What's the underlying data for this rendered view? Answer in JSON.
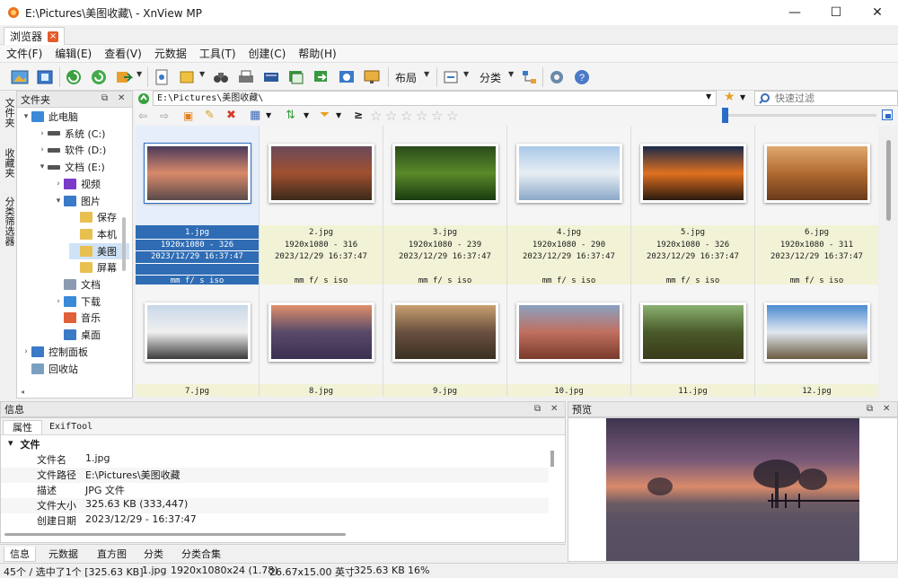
{
  "window": {
    "title": "E:\\Pictures\\美图收藏\\ - XnView MP",
    "tab": "浏览器",
    "tab_close": "×",
    "minimize": "—",
    "maximize": "☐",
    "close": "✕"
  },
  "menu": [
    "文件(F)",
    "编辑(E)",
    "查看(V)",
    "元数据",
    "工具(T)",
    "创建(C)",
    "帮助(H)"
  ],
  "toolbar": {
    "layout_label": "布局",
    "category_label": "分类"
  },
  "side_tabs": [
    "文件夹",
    "收藏夹",
    "分类筛选器"
  ],
  "folder_panel": {
    "title": "文件夹",
    "tree": [
      {
        "label": "此电脑",
        "icon": "computer-icon",
        "chev": "▾"
      },
      {
        "label": "系统 (C:)",
        "icon": "drive-icon",
        "chev": "›"
      },
      {
        "label": "软件 (D:)",
        "icon": "drive-icon",
        "chev": "›"
      },
      {
        "label": "文档 (E:)",
        "icon": "drive-icon",
        "chev": "▾"
      },
      {
        "label": "视频",
        "icon": "video-folder-icon",
        "chev": "›"
      },
      {
        "label": "图片",
        "icon": "pictures-folder-icon",
        "chev": "▾"
      },
      {
        "label": "保存",
        "icon": "folder-icon",
        "chev": ""
      },
      {
        "label": "本机",
        "icon": "folder-icon",
        "chev": ""
      },
      {
        "label": "美图",
        "icon": "folder-icon",
        "chev": ""
      },
      {
        "label": "屏幕",
        "icon": "folder-icon",
        "chev": ""
      },
      {
        "label": "文档",
        "icon": "documents-folder-icon",
        "chev": ""
      },
      {
        "label": "下载",
        "icon": "download-folder-icon",
        "chev": "›"
      },
      {
        "label": "音乐",
        "icon": "music-folder-icon",
        "chev": ""
      },
      {
        "label": "桌面",
        "icon": "desktop-folder-icon",
        "chev": ""
      },
      {
        "label": "控制面板",
        "icon": "control-panel-icon",
        "chev": "›"
      },
      {
        "label": "回收站",
        "icon": "recycle-bin-icon",
        "chev": ""
      }
    ]
  },
  "address": {
    "path": "E:\\Pictures\\美图收藏\\",
    "filter_placeholder": "快速过滤",
    "compare_symbol": "≥"
  },
  "thumbnails": [
    {
      "name": "1.jpg",
      "size": "1920x1080 - 326",
      "date": "2023/12/29 16:37:47",
      "exif": "mm f/ s iso",
      "colors": [
        "#4a3a5a",
        "#d98a6a",
        "#5a4a4a"
      ]
    },
    {
      "name": "2.jpg",
      "size": "1920x1080 - 316",
      "date": "2023/12/29 16:37:47",
      "exif": "mm f/ s iso",
      "colors": [
        "#6a4a5a",
        "#a05030",
        "#3a2a1a"
      ]
    },
    {
      "name": "3.jpg",
      "size": "1920x1080 - 239",
      "date": "2023/12/29 16:37:47",
      "exif": "mm f/ s iso",
      "colors": [
        "#2a4a1a",
        "#5a8a2a",
        "#1a3a10"
      ]
    },
    {
      "name": "4.jpg",
      "size": "1920x1080 - 290",
      "date": "2023/12/29 16:37:47",
      "exif": "mm f/ s iso",
      "colors": [
        "#a8c8e8",
        "#e8eef4",
        "#8aa8c8"
      ]
    },
    {
      "name": "5.jpg",
      "size": "1920x1080 - 326",
      "date": "2023/12/29 16:37:47",
      "exif": "mm f/ s iso",
      "colors": [
        "#1a2a4a",
        "#e07020",
        "#2a1a10"
      ]
    },
    {
      "name": "6.jpg",
      "size": "1920x1080 - 311",
      "date": "2023/12/29 16:37:47",
      "exif": "mm f/ s iso",
      "colors": [
        "#e0a870",
        "#b06a30",
        "#6a3a1a"
      ]
    },
    {
      "name": "7.jpg",
      "colors": [
        "#c8d8e8",
        "#f0f0f0",
        "#3a3a3a"
      ]
    },
    {
      "name": "8.jpg",
      "colors": [
        "#e0906a",
        "#5a4a6a",
        "#3a3050"
      ]
    },
    {
      "name": "9.jpg",
      "colors": [
        "#c8a070",
        "#6a5040",
        "#3a3020"
      ]
    },
    {
      "name": "10.jpg",
      "colors": [
        "#8aa0c0",
        "#c07060",
        "#7a3a2a"
      ]
    },
    {
      "name": "11.jpg",
      "colors": [
        "#8ab070",
        "#4a5a2a",
        "#3a3a1a"
      ]
    },
    {
      "name": "12.jpg",
      "colors": [
        "#4a8ad0",
        "#e0e8f0",
        "#6a5a40"
      ]
    }
  ],
  "info_panel": {
    "title": "信息",
    "subtabs": [
      "属性",
      "ExifTool"
    ],
    "section": "文件",
    "section_chev": "▾",
    "rows": [
      {
        "key": "文件名",
        "value": "1.jpg"
      },
      {
        "key": "文件路径",
        "value": "E:\\Pictures\\美图收藏"
      },
      {
        "key": "描述",
        "value": "JPG 文件"
      },
      {
        "key": "文件大小",
        "value": "325.63 KB (333,447)"
      },
      {
        "key": "创建日期",
        "value": "2023/12/29 - 16:37:47"
      }
    ],
    "bottom_tabs": [
      "信息",
      "元数据",
      "直方图",
      "分类",
      "分类合集"
    ]
  },
  "preview_panel": {
    "title": "预览"
  },
  "status": {
    "count": "45个 / 选中了1个 [325.63 KB]",
    "file": "1.jpg",
    "dims": "1920x1080x24 (1.78)",
    "physical": "26.67x15.00 英寸",
    "size": "325.63 KB",
    "zoom": "16%"
  },
  "colors": {
    "selection": "#2f6cb4",
    "meta_bg": "#f2f2d6",
    "accent_orange": "#e35a2b"
  }
}
